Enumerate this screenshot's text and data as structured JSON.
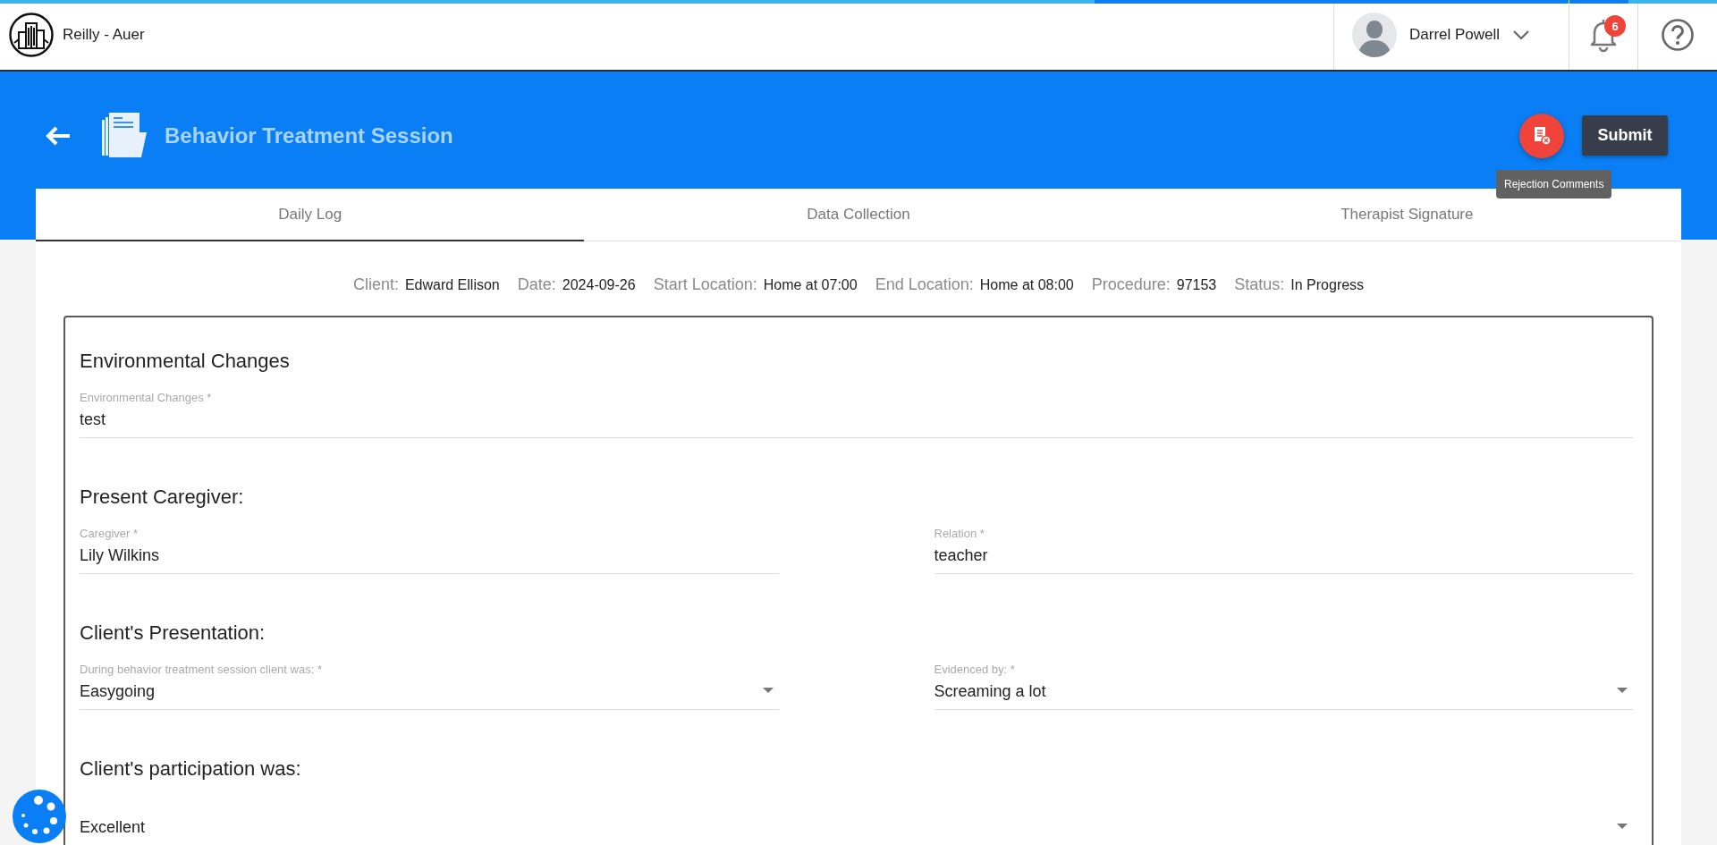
{
  "app": {
    "company": "Reilly - Auer"
  },
  "user": {
    "name": "Darrel Powell"
  },
  "notifications": {
    "count": "6"
  },
  "header": {
    "title": "Behavior Treatment Session",
    "tooltip": "Rejection Comments",
    "submit": "Submit"
  },
  "tabs": [
    {
      "label": "Daily Log",
      "selected": true
    },
    {
      "label": "Data Collection",
      "selected": false
    },
    {
      "label": "Therapist Signature",
      "selected": false
    }
  ],
  "session_info": [
    {
      "label": "Client:",
      "value": "Edward Ellison"
    },
    {
      "label": "Date:",
      "value": "2024-09-26"
    },
    {
      "label": "Start Location:",
      "value": "Home at 07:00"
    },
    {
      "label": "End Location:",
      "value": "Home at 08:00"
    },
    {
      "label": "Procedure:",
      "value": "97153"
    },
    {
      "label": "Status:",
      "value": "In Progress"
    }
  ],
  "sections": [
    {
      "title": "Environmental Changes",
      "fields": [
        {
          "kind": "text",
          "label": "Environmental Changes *",
          "value": "test",
          "wide": true
        }
      ]
    },
    {
      "title": "Present Caregiver:",
      "fields": [
        {
          "kind": "text",
          "label": "Caregiver *",
          "value": "Lily Wilkins",
          "wide": false
        },
        {
          "kind": "text",
          "label": "Relation *",
          "value": "teacher",
          "wide": false
        }
      ]
    },
    {
      "title": "Client's Presentation:",
      "fields": [
        {
          "kind": "select",
          "label": "During behavior treatment session client was: *",
          "value": "Easygoing",
          "wide": false
        },
        {
          "kind": "select",
          "label": "Evidenced by: *",
          "value": "Screaming a lot",
          "wide": false
        }
      ]
    },
    {
      "title": "Client's participation was:",
      "fields": [
        {
          "kind": "select",
          "value": "Excellent",
          "wide": true
        }
      ]
    }
  ]
}
